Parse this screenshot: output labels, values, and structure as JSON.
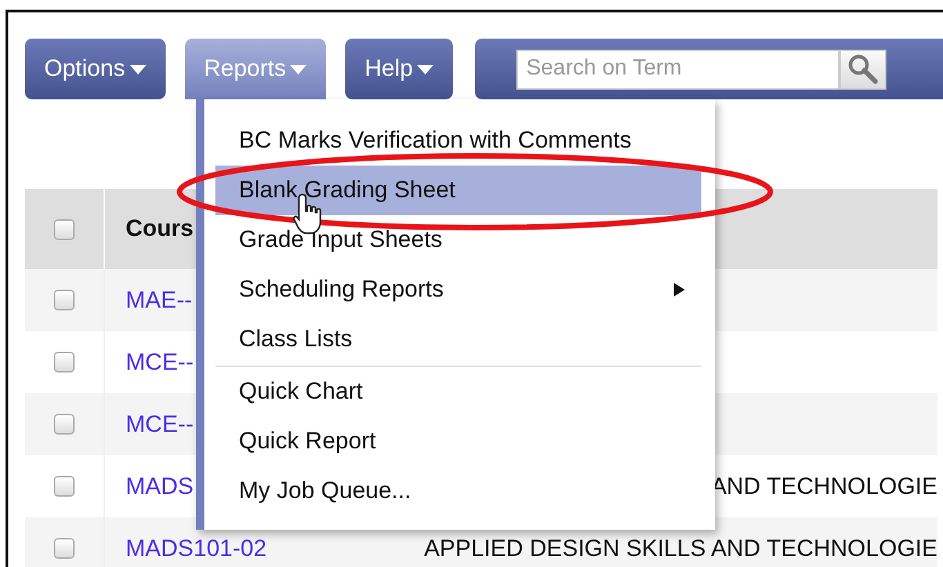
{
  "toolbar": {
    "menus": [
      {
        "label": "Options",
        "selected": false
      },
      {
        "label": "Reports",
        "selected": true
      },
      {
        "label": "Help",
        "selected": false
      }
    ],
    "search": {
      "placeholder": "Search on Term"
    }
  },
  "table": {
    "header": {
      "checked": false,
      "column_2": "Cours"
    },
    "rows": [
      {
        "checked": false,
        "column_2": "MAE--"
      },
      {
        "checked": false,
        "column_2": "MCE--"
      },
      {
        "checked": false,
        "column_2": "MCE--"
      },
      {
        "checked": false,
        "column_2": "MADS",
        "column_3": "AND TECHNOLOGIE"
      },
      {
        "checked": false,
        "column_2": "MADS101-02",
        "column_3": "APPLIED DESIGN SKILLS AND TECHNOLOGIE"
      }
    ]
  },
  "reports_menu": {
    "groups": [
      [
        {
          "label": "BC Marks Verification with Comments",
          "selected": false,
          "has_submenu": false
        },
        {
          "label": "Blank Grading Sheet",
          "selected": true,
          "has_submenu": false
        },
        {
          "label": "Grade Input Sheets",
          "selected": false,
          "has_submenu": false
        },
        {
          "label": "Scheduling Reports",
          "selected": false,
          "has_submenu": true
        },
        {
          "label": "Class Lists",
          "selected": false,
          "has_submenu": false
        }
      ],
      [
        {
          "label": "Quick Chart",
          "selected": false,
          "has_submenu": false
        },
        {
          "label": "Quick Report",
          "selected": false,
          "has_submenu": false
        },
        {
          "label": "My Job Queue...",
          "selected": false,
          "has_submenu": false
        }
      ]
    ]
  }
}
